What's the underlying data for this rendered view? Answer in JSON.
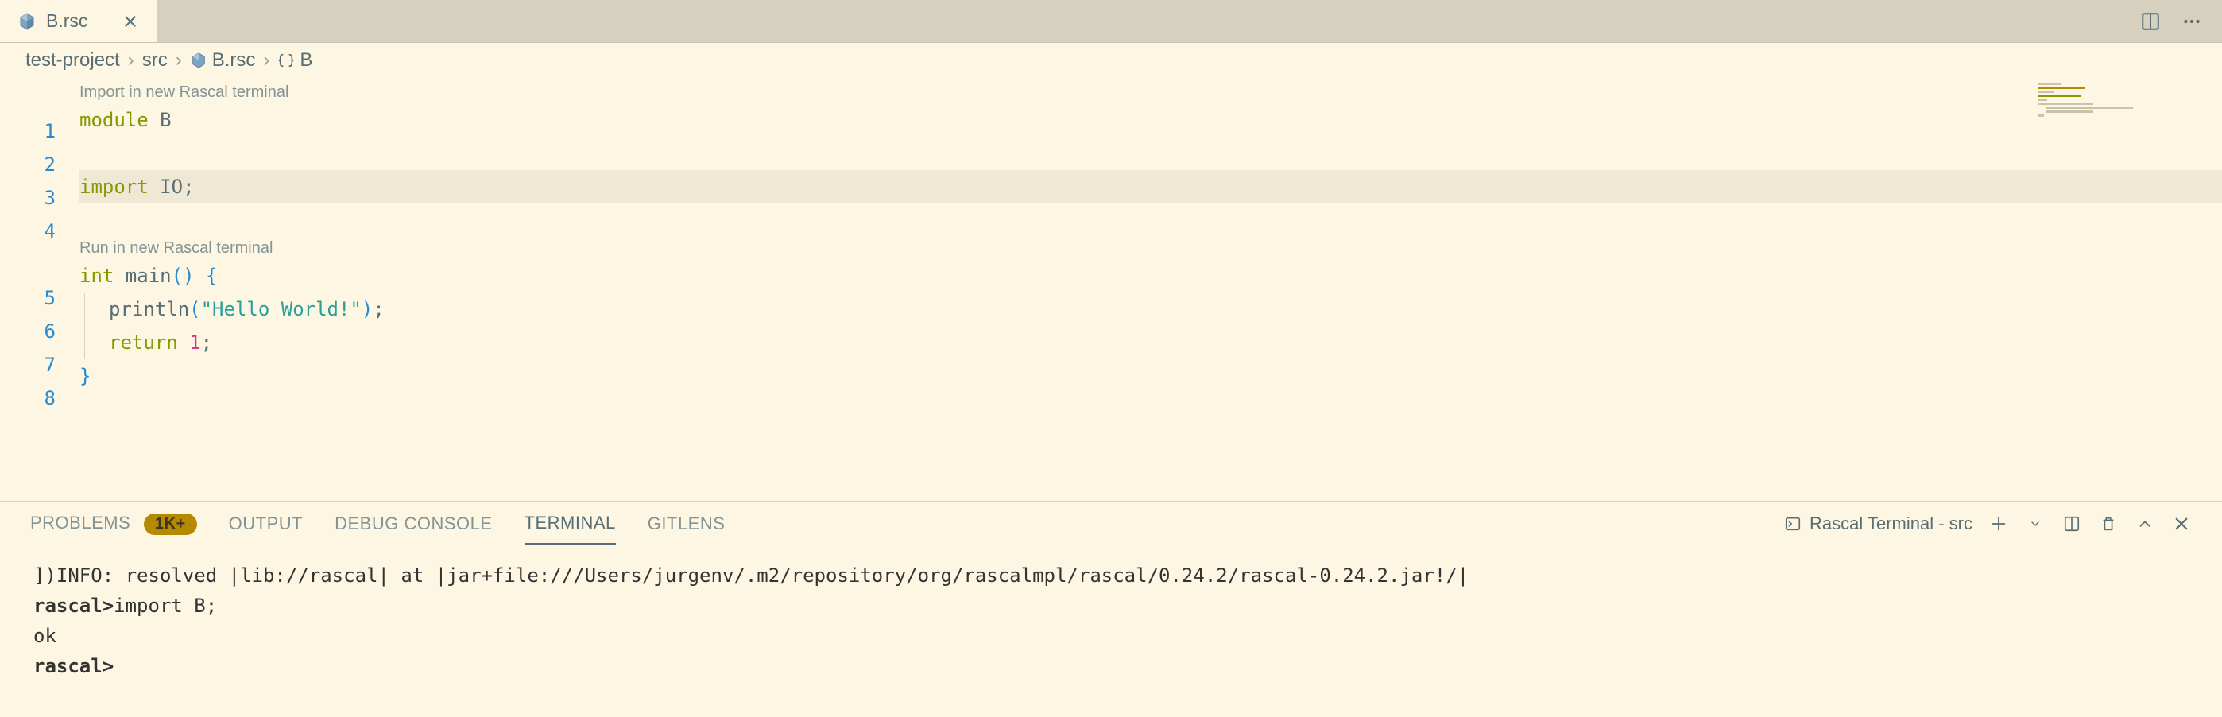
{
  "tab": {
    "filename": "B.rsc"
  },
  "editor_actions": {
    "split": "split-editor",
    "more": "more-actions"
  },
  "breadcrumb": {
    "part1": "test-project",
    "part2": "src",
    "part3": "B.rsc",
    "part4": "B",
    "sep": "›"
  },
  "codelens": {
    "import": "Import in new Rascal terminal",
    "run": "Run in new Rascal terminal"
  },
  "code": {
    "l1_kw": "module",
    "l1_name": " B",
    "l3_kw": "import",
    "l3_name": " IO",
    "l3_semi": ";",
    "l5_type": "int",
    "l5_name": " main",
    "l5_par_open": "(",
    "l5_par_close": ")",
    "l5_brace_open": " {",
    "l6_fn": "println",
    "l6_par_open": "(",
    "l6_str": "\"Hello World!\"",
    "l6_par_close": ")",
    "l6_semi": ";",
    "l7_kw": "return",
    "l7_num": " 1",
    "l7_semi": ";",
    "l8_brace_close": "}"
  },
  "gutter": {
    "l1": "1",
    "l2": "2",
    "l3": "3",
    "l4": "4",
    "l5": "5",
    "l6": "6",
    "l7": "7",
    "l8": "8"
  },
  "panel": {
    "tabs": {
      "problems": "PROBLEMS",
      "problems_badge": "1K+",
      "output": "OUTPUT",
      "debug": "DEBUG CONSOLE",
      "terminal": "TERMINAL",
      "gitlens": "GITLENS"
    },
    "terminal_name": "Rascal Terminal - src"
  },
  "terminal": {
    "line1": "])INFO: resolved |lib://rascal| at |jar+file:///Users/jurgenv/.m2/repository/org/rascalmpl/rascal/0.24.2/rascal-0.24.2.jar!/|",
    "prompt": "rascal>",
    "line2_cmd": "import B;",
    "line3": "ok",
    "line4_prompt": "rascal>"
  }
}
